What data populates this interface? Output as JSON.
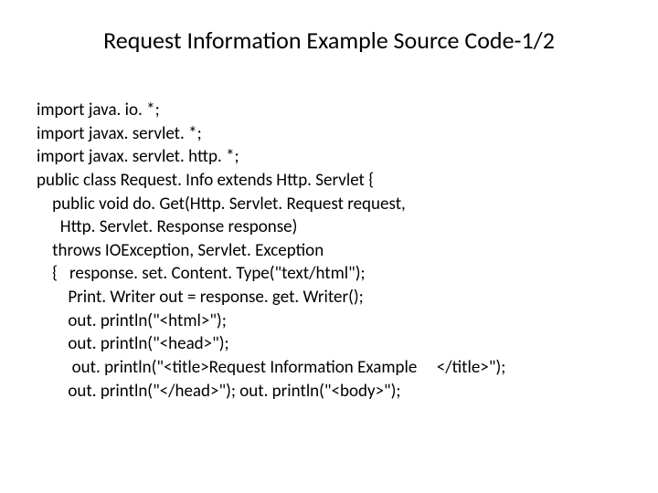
{
  "title": "Request Information Example Source Code-1/2",
  "code": {
    "lines": [
      "import java. io. *;",
      "import javax. servlet. *;",
      "import javax. servlet. http. *;",
      "public class Request. Info extends Http. Servlet {",
      "    public void do. Get(Http. Servlet. Request request,",
      "      Http. Servlet. Response response)",
      "    throws IOException, Servlet. Exception",
      "    {   response. set. Content. Type(\"text/html\");",
      "        Print. Writer out = response. get. Writer();",
      "        out. println(\"<html>\");",
      "        out. println(\"<head>\");",
      "         out. println(\"<title>Request Information Example     </title>\");",
      "        out. println(\"</head>\"); out. println(\"<body>\");"
    ]
  }
}
